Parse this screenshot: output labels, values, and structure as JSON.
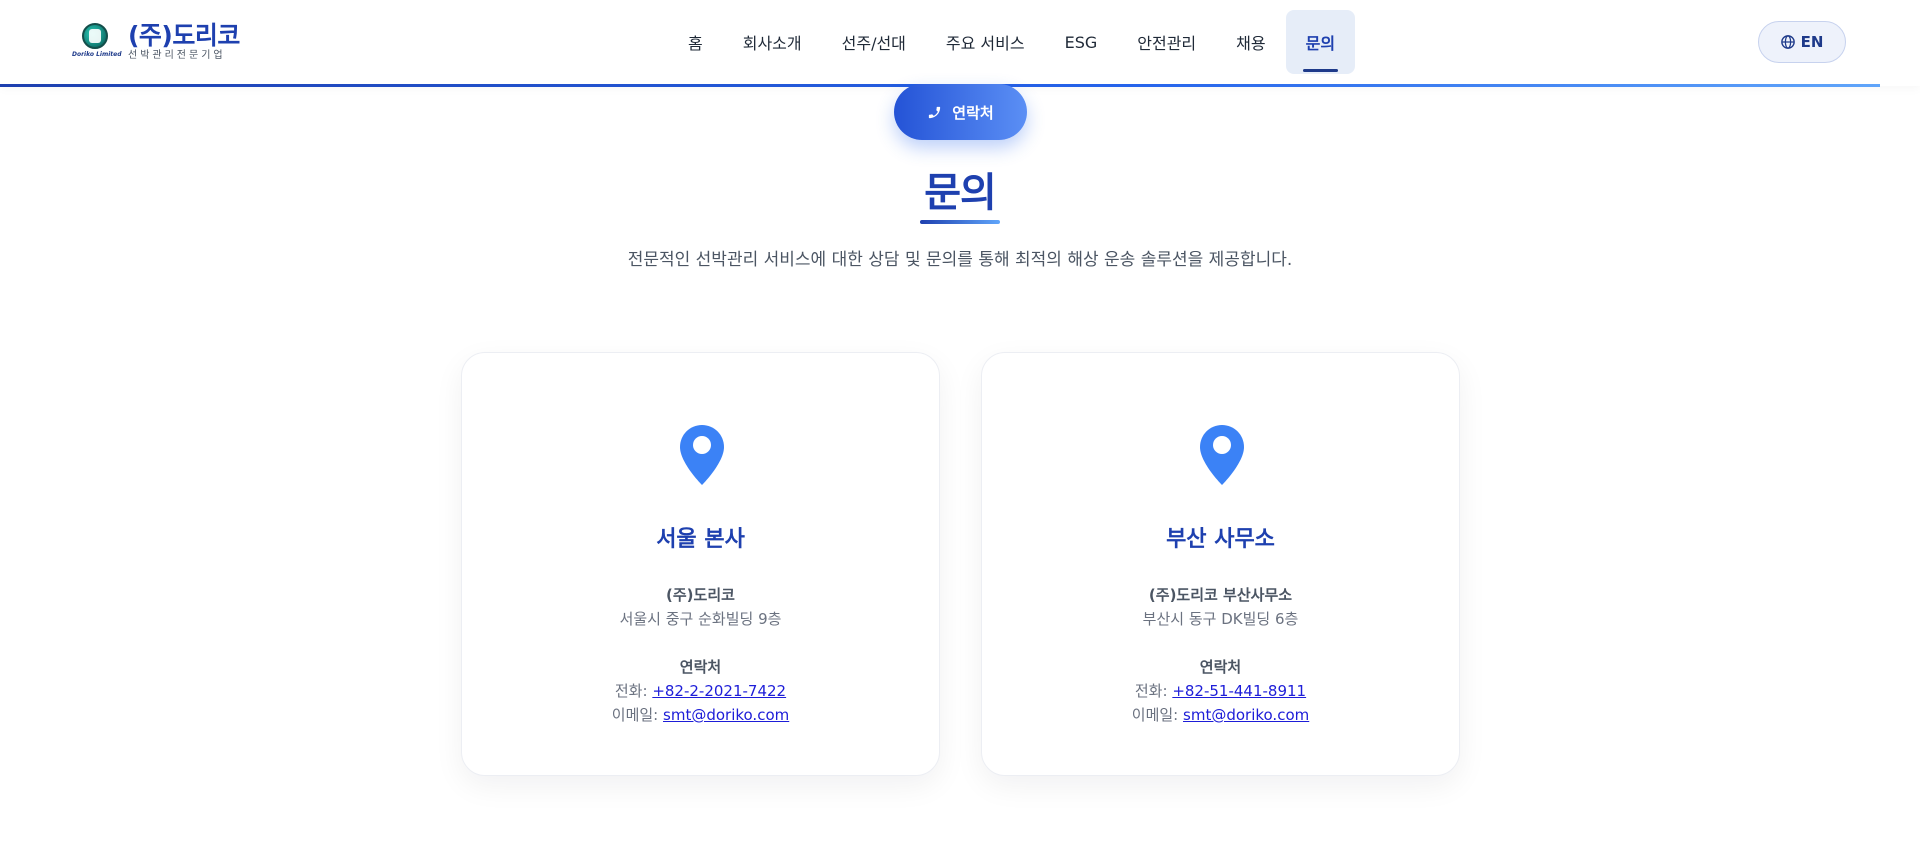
{
  "header": {
    "logo_caption": "Doriko Limited",
    "company_name": "(주)도리코",
    "company_tagline": "선박관리전문기업",
    "nav": [
      {
        "label": "홈"
      },
      {
        "label": "회사소개"
      },
      {
        "label": "선주/선대"
      },
      {
        "label": "주요 서비스"
      },
      {
        "label": "ESG"
      },
      {
        "label": "안전관리"
      },
      {
        "label": "채용"
      },
      {
        "label": "문의",
        "active": true
      }
    ],
    "lang_label": "EN"
  },
  "contact_badge": {
    "label": "연락처",
    "icon": "phone-icon"
  },
  "section": {
    "title": "문의",
    "subtitle": "전문적인 선박관리 서비스에 대한 상담 및 문의를 통해 최적의 해상 운송 솔루션을 제공합니다."
  },
  "offices": [
    {
      "title": "서울 본사",
      "company": "(주)도리코",
      "address": "서울시 중구 순화빌딩 9층",
      "contact_heading": "연락처",
      "phone_label": "전화:",
      "phone": "+82-2-2021-7422",
      "email_label": "이메일:",
      "email": "smt@doriko.com"
    },
    {
      "title": "부산 사무소",
      "company": "(주)도리코 부산사무소",
      "address": "부산시 동구 DK빌딩 6층",
      "contact_heading": "연락처",
      "phone_label": "전화:",
      "phone": "+82-51-441-8911",
      "email_label": "이메일:",
      "email": "smt@doriko.com"
    }
  ],
  "colors": {
    "brand": "#1e40af",
    "accent": "#3b82f6",
    "pin": "#3b82f6"
  }
}
